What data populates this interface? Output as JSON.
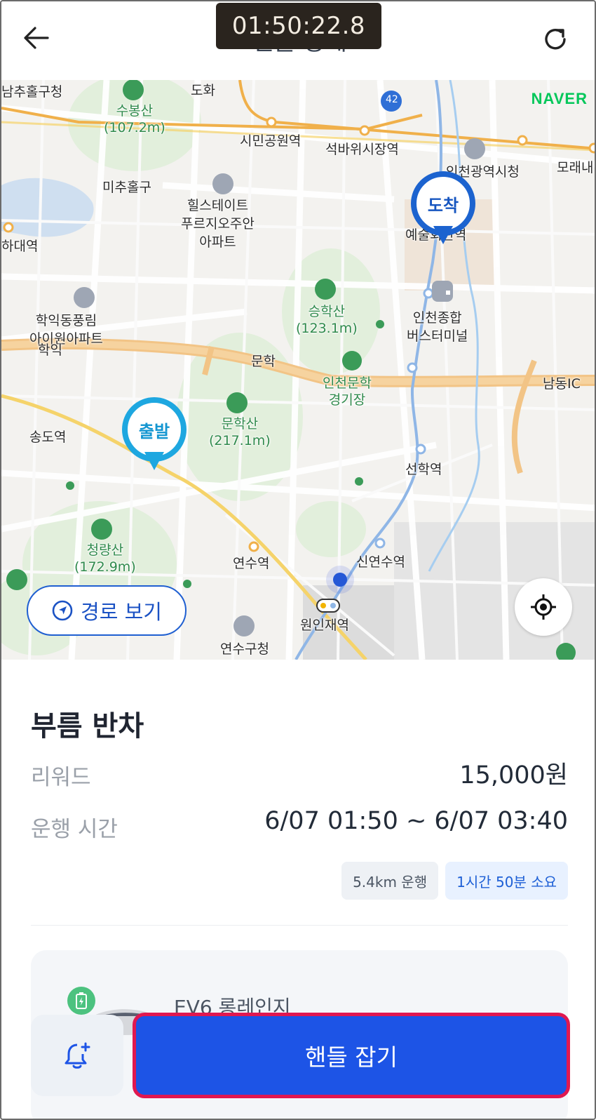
{
  "header": {
    "title": "핸들 상세",
    "timer": "01:50:22.8",
    "back_icon": "arrow-left-icon",
    "refresh_icon": "refresh-icon"
  },
  "map": {
    "brand": "NAVER",
    "pins": {
      "start": "출발",
      "end": "도착"
    },
    "labels": {
      "l1": "남추홀구청",
      "l2": "도화",
      "l3": "수봉산",
      "l3e": "(107.2m)",
      "l4": "시민공원역",
      "l5": "석바위시장역",
      "l6": "인천광역시청",
      "l7": "모래내",
      "l8": "미추홀구",
      "l9": "힐스테이트",
      "l9b": "푸르지오주안",
      "l9c": "아파트",
      "l10": "예술회관역",
      "l11": "하대역",
      "l12": "승학산",
      "l12e": "(123.1m)",
      "l13": "인천종합",
      "l13b": "버스터미널",
      "l14": "학익동풍림",
      "l14b": "아이원아파트",
      "l15": "학익",
      "l16": "문학",
      "l17": "인천문학",
      "l17b": "경기장",
      "l18": "남동IC",
      "l19": "송도역",
      "l20": "문학산",
      "l20e": "(217.1m)",
      "l21": "선학역",
      "l22": "청량산",
      "l22e": "(172.9m)",
      "l23": "연수역",
      "l24": "신연수역",
      "l25": "원인재역",
      "l26": "연수구청",
      "route_badge": "42"
    },
    "route_button": "경로 보기",
    "locate_icon": "crosshair-icon"
  },
  "detail": {
    "title": "부름 반차",
    "reward_label": "리워드",
    "reward_value": "15,000원",
    "time_label": "운행 시간",
    "time_value": "6/07 01:50 ~ 6/07 03:40",
    "distance_badge": "5.4km 운행",
    "duration_badge": "1시간 50분 소요",
    "car_name": "EV6 롱레인지"
  },
  "actions": {
    "grab_label": "핸들 잡기",
    "alarm_icon": "bell-plus-icon"
  },
  "colors": {
    "primary": "#1d54e6",
    "highlight_border": "#e01850",
    "start_pin": "#1ea7e0",
    "end_pin": "#1c63cf"
  }
}
